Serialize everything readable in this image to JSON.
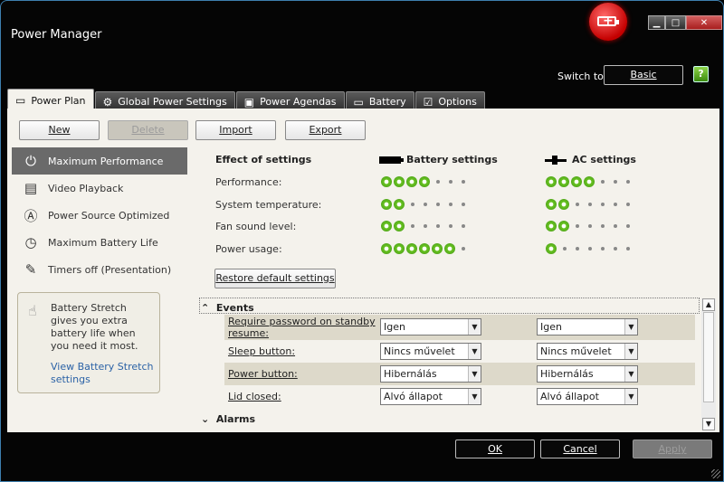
{
  "window": {
    "title": "Power Manager",
    "controls": {
      "minimize": "▁",
      "maximize": "□",
      "close": "✕"
    }
  },
  "header": {
    "switch_label": "Switch to:",
    "switch_button": "Basic",
    "help_icon": "?"
  },
  "tabs": [
    {
      "label": "Power Plan",
      "icon": "▭",
      "active": true
    },
    {
      "label": "Global Power Settings",
      "icon": "⚙"
    },
    {
      "label": "Power Agendas",
      "icon": "▣"
    },
    {
      "label": "Battery",
      "icon": "▭"
    },
    {
      "label": "Options",
      "icon": "☑"
    }
  ],
  "toolbar": {
    "new": "New",
    "delete": "Delete",
    "import": "Import",
    "export": "Export"
  },
  "plans": [
    {
      "label": "Maximum Performance",
      "icon": "power-icon",
      "glyph": "⏻",
      "selected": true
    },
    {
      "label": "Video Playback",
      "icon": "film-icon",
      "glyph": "▤"
    },
    {
      "label": "Power Source Optimized",
      "icon": "auto-icon",
      "glyph": "Ⓐ"
    },
    {
      "label": "Maximum Battery Life",
      "icon": "battery-clock-icon",
      "glyph": "◷"
    },
    {
      "label": "Timers off (Presentation)",
      "icon": "presentation-icon",
      "glyph": "✎"
    }
  ],
  "stretch": {
    "text": "Battery Stretch gives you extra battery life when you need it most.",
    "link": "View Battery Stretch settings"
  },
  "effects": {
    "heading": "Effect of settings",
    "battery_heading": "Battery settings",
    "ac_heading": "AC settings",
    "rows": [
      {
        "label": "Performance:",
        "battery": 4,
        "ac": 4,
        "max": 7
      },
      {
        "label": "System temperature:",
        "battery": 2,
        "ac": 2,
        "max": 7
      },
      {
        "label": "Fan sound level:",
        "battery": 2,
        "ac": 2,
        "max": 7
      },
      {
        "label": "Power usage:",
        "battery": 6,
        "ac": 1,
        "max": 7
      }
    ],
    "restore": "Restore default settings"
  },
  "events": {
    "heading": "Events",
    "rows": [
      {
        "label": "Require password on standby resume:",
        "battery": "Igen",
        "ac": "Igen"
      },
      {
        "label": "Sleep button:",
        "battery": "Nincs művelet",
        "ac": "Nincs művelet"
      },
      {
        "label": "Power button:",
        "battery": "Hibernálás",
        "ac": "Hibernálás"
      },
      {
        "label": "Lid closed:",
        "battery": "Alvó állapot",
        "ac": "Alvó állapot"
      }
    ]
  },
  "alarms": {
    "heading": "Alarms"
  },
  "footer": {
    "ok": "OK",
    "cancel": "Cancel",
    "apply": "Apply"
  }
}
